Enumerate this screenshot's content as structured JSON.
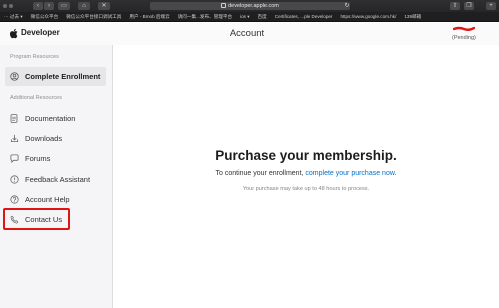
{
  "browser": {
    "url": "developer.apple.com",
    "bookmarks": [
      "⋯ 过去 ▾",
      "微信公众平台",
      "微信公众平台接口调试工具",
      "用户 - Bmob 后端云",
      "请问一集...发布、管理平台",
      "ios ▾",
      "百度",
      "Certificates, ...ple Developer",
      "https://www.google.com.hk/",
      "139邮箱"
    ]
  },
  "header": {
    "brand": "Developer",
    "title": "Account",
    "status": "(Pending)"
  },
  "sidebar": {
    "section_program": "Program Resources",
    "section_additional": "Additional Resources",
    "items": [
      {
        "label": "Complete Enrollment",
        "icon": "user-circle-icon"
      },
      {
        "label": "Documentation",
        "icon": "document-icon"
      },
      {
        "label": "Downloads",
        "icon": "download-icon"
      },
      {
        "label": "Forums",
        "icon": "chat-bubble-icon"
      },
      {
        "label": "Feedback Assistant",
        "icon": "feedback-icon"
      },
      {
        "label": "Account Help",
        "icon": "help-icon"
      },
      {
        "label": "Contact Us",
        "icon": "phone-icon"
      }
    ]
  },
  "main": {
    "headline": "Purchase your membership.",
    "body_prefix": "To continue your enrollment, ",
    "body_link": "complete your purchase now",
    "body_suffix": ".",
    "note": "Your purchase may take up to 48 hours to process."
  },
  "colors": {
    "accent_link": "#0070c9",
    "highlight": "#e11414"
  }
}
